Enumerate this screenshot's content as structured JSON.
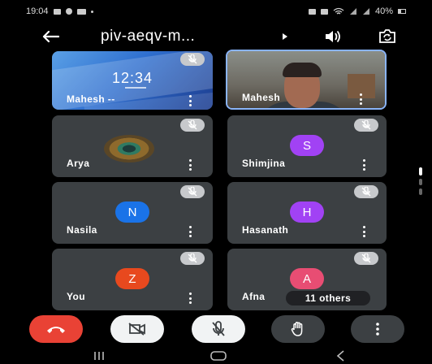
{
  "status_bar": {
    "time": "19:04",
    "battery_text": "40%",
    "icons": [
      "message-icon",
      "settings-icon",
      "cast-icon",
      "dot-icon",
      "camera-icon",
      "mute-icon",
      "wifi-icon",
      "signal-icon",
      "signal-icon",
      "battery-icon"
    ]
  },
  "app_bar": {
    "title": "piv-aeqv-m...",
    "icons": [
      "back-arrow-icon",
      "expand-arrow-icon",
      "speaker-icon",
      "switch-camera-icon"
    ]
  },
  "tiles": [
    {
      "name": "Mahesh --",
      "type": "screen-share",
      "clock": "12:34",
      "muted": true
    },
    {
      "name": "Mahesh",
      "type": "camera",
      "muted": false,
      "highlighted": true
    },
    {
      "name": "Arya",
      "type": "avatar-image",
      "muted": true
    },
    {
      "name": "Shimjina",
      "type": "avatar-letter",
      "letter": "S",
      "color": "#a142f4",
      "muted": true
    },
    {
      "name": "Nasila",
      "type": "avatar-letter",
      "letter": "N",
      "color": "#1a73e8",
      "muted": true
    },
    {
      "name": "Hasanath",
      "type": "avatar-letter",
      "letter": "H",
      "color": "#a142f4",
      "muted": true
    },
    {
      "name": "You",
      "type": "avatar-letter",
      "letter": "Z",
      "color": "#e8491e",
      "muted": true
    },
    {
      "name": "Afna",
      "type": "avatar-letter",
      "letter": "A",
      "color": "#e84d73",
      "muted": true
    }
  ],
  "others_chip": "11 others",
  "controls": [
    {
      "icon": "end-call-icon",
      "style": "end"
    },
    {
      "icon": "camera-off-icon",
      "style": "light"
    },
    {
      "icon": "mic-off-icon",
      "style": "light"
    },
    {
      "icon": "raise-hand-icon",
      "style": "dark"
    },
    {
      "icon": "more-options-icon",
      "style": "dark"
    }
  ],
  "nav_bar": [
    "recent-apps-icon",
    "home-icon",
    "back-icon"
  ],
  "colors": {
    "tile_bg": "#3c4043",
    "highlight": "#8ab4f8",
    "end_call": "#e94235",
    "control_light": "#f1f3f4"
  }
}
